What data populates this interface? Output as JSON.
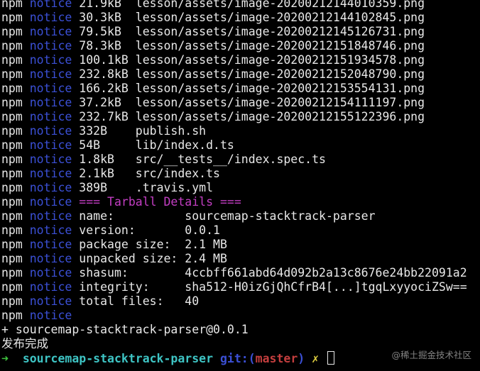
{
  "terminal": {
    "notice_lines": [
      {
        "npm": "npm",
        "level": "notice",
        "text": "21.9kB  lesson/assets/image-20200212144010359.png"
      },
      {
        "npm": "npm",
        "level": "notice",
        "text": "30.3kB  lesson/assets/image-20200212144102845.png"
      },
      {
        "npm": "npm",
        "level": "notice",
        "text": "79.5kB  lesson/assets/image-20200212145126731.png"
      },
      {
        "npm": "npm",
        "level": "notice",
        "text": "78.3kB  lesson/assets/image-20200212151848746.png"
      },
      {
        "npm": "npm",
        "level": "notice",
        "text": "100.1kB lesson/assets/image-20200212151934578.png"
      },
      {
        "npm": "npm",
        "level": "notice",
        "text": "232.8kB lesson/assets/image-20200212152048790.png"
      },
      {
        "npm": "npm",
        "level": "notice",
        "text": "166.2kB lesson/assets/image-20200212153554131.png"
      },
      {
        "npm": "npm",
        "level": "notice",
        "text": "37.2kB  lesson/assets/image-20200212154111197.png"
      },
      {
        "npm": "npm",
        "level": "notice",
        "text": "232.7kB lesson/assets/image-20200212155122396.png"
      },
      {
        "npm": "npm",
        "level": "notice",
        "text": "332B    publish.sh"
      },
      {
        "npm": "npm",
        "level": "notice",
        "text": "54B     lib/index.d.ts"
      },
      {
        "npm": "npm",
        "level": "notice",
        "text": "1.8kB   src/__tests__/index.spec.ts"
      },
      {
        "npm": "npm",
        "level": "notice",
        "text": "2.1kB   src/index.ts"
      },
      {
        "npm": "npm",
        "level": "notice",
        "text": "389B    .travis.yml"
      }
    ],
    "tarball_header": {
      "npm": "npm",
      "level": "notice",
      "text": "=== Tarball Details ==="
    },
    "details_lines": [
      {
        "npm": "npm",
        "level": "notice",
        "text": "name:          sourcemap-stacktrack-parser"
      },
      {
        "npm": "npm",
        "level": "notice",
        "text": "version:       0.0.1"
      },
      {
        "npm": "npm",
        "level": "notice",
        "text": "package size:  2.1 MB"
      },
      {
        "npm": "npm",
        "level": "notice",
        "text": "unpacked size: 2.4 MB"
      },
      {
        "npm": "npm",
        "level": "notice",
        "text": "shasum:        4ccbff661abd64d092b2a13c8676e24bb22091a2"
      },
      {
        "npm": "npm",
        "level": "notice",
        "text": "integrity:     sha512-H0izGjQhCfrB4[...]tgqLxyyociZSw=="
      },
      {
        "npm": "npm",
        "level": "notice",
        "text": "total files:   40"
      },
      {
        "npm": "npm",
        "level": "notice",
        "text": ""
      }
    ],
    "publish_result": "+ sourcemap-stacktrack-parser@0.0.1",
    "done_message": "发布完成",
    "prompt": {
      "arrow": "➜",
      "directory": "sourcemap-stacktrack-parser",
      "git_label": "git:",
      "branch_open": "(",
      "branch": "master",
      "branch_close": ")",
      "dirty_marker": "✗"
    }
  },
  "watermark": "@稀土掘金技术社区",
  "colors": {
    "background": "#000000",
    "foreground": "#e8e8e8",
    "notice_blue": "#3b50d6",
    "header_magenta": "#c43ec4",
    "prompt_green": "#3ec43e",
    "prompt_cyan": "#3ec4c4",
    "branch_red": "#c43e3e",
    "dirty_yellow": "#e0d040"
  }
}
